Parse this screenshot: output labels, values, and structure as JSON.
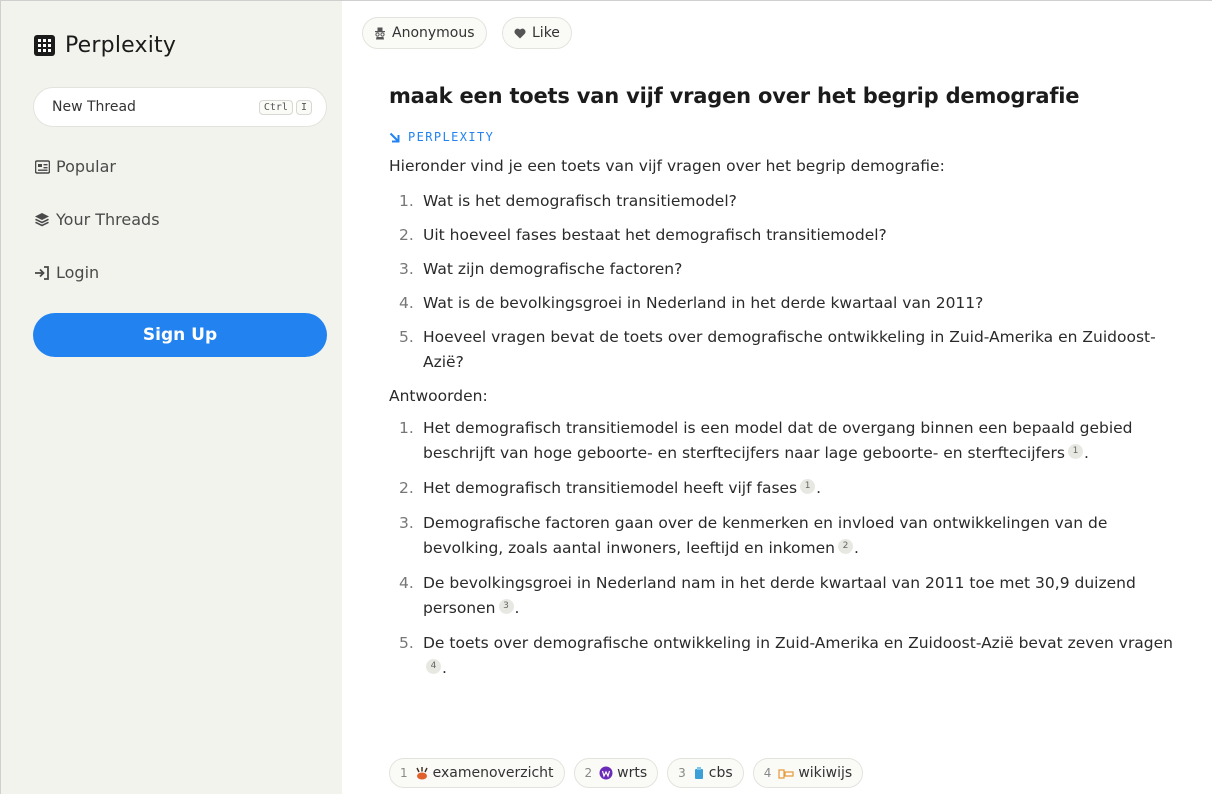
{
  "sidebar": {
    "logo_text": "Perplexity",
    "new_thread": {
      "label": "New Thread",
      "shortcut_1": "Ctrl",
      "shortcut_2": "I"
    },
    "nav": {
      "popular": "Popular",
      "your_threads": "Your Threads",
      "login": "Login"
    },
    "signup_label": "Sign Up"
  },
  "header": {
    "anonymous_label": "Anonymous",
    "like_label": "Like"
  },
  "thread": {
    "question": "maak een toets van vijf vragen over het begrip demografie",
    "source_label": "PERPLEXITY",
    "intro": "Hieronder vind je een toets van vijf vragen over het begrip demografie:",
    "questions": [
      {
        "num": "1.",
        "text": "Wat is het demografisch transitiemodel?"
      },
      {
        "num": "2.",
        "text": "Uit hoeveel fases bestaat het demografisch transitiemodel?"
      },
      {
        "num": "3.",
        "text": "Wat zijn demografische factoren?"
      },
      {
        "num": "4.",
        "text": "Wat is de bevolkingsgroei in Nederland in het derde kwartaal van 2011?"
      },
      {
        "num": "5.",
        "text": "Hoeveel vragen bevat de toets over demografische ontwikkeling in Zuid-Amerika en Zuidoost-Azië?"
      }
    ],
    "answers_heading": "Antwoorden:",
    "answers": [
      {
        "num": "1.",
        "text": "Het demografisch transitiemodel is een model dat de overgang binnen een bepaald gebied beschrijft van hoge geboorte- en sterftecijfers naar lage geboorte- en sterftecijfers",
        "cite": "1"
      },
      {
        "num": "2.",
        "text": "Het demografisch transitiemodel heeft vijf fases",
        "cite": "1"
      },
      {
        "num": "3.",
        "text": "Demografische factoren gaan over de kenmerken en invloed van ontwikkelingen van de bevolking, zoals aantal inwoners, leeftijd en inkomen",
        "cite": "2"
      },
      {
        "num": "4.",
        "text": "De bevolkingsgroei in Nederland nam in het derde kwartaal van 2011 toe met 30,9 duizend personen",
        "cite": "3"
      },
      {
        "num": "5.",
        "text": "De toets over demografische ontwikkeling in Zuid-Amerika en Zuidoost-Azië bevat zeven vragen",
        "cite": "4"
      }
    ],
    "sources": [
      {
        "num": "1",
        "name": "examenoverzicht",
        "icon": "examenoverzicht-icon"
      },
      {
        "num": "2",
        "name": "wrts",
        "icon": "wrts-icon"
      },
      {
        "num": "3",
        "name": "cbs",
        "icon": "cbs-icon"
      },
      {
        "num": "4",
        "name": "wikiwijs",
        "icon": "wikiwijs-icon"
      }
    ]
  },
  "colors": {
    "accent": "#2283f0",
    "sidebar_bg": "#f3f3ee"
  }
}
